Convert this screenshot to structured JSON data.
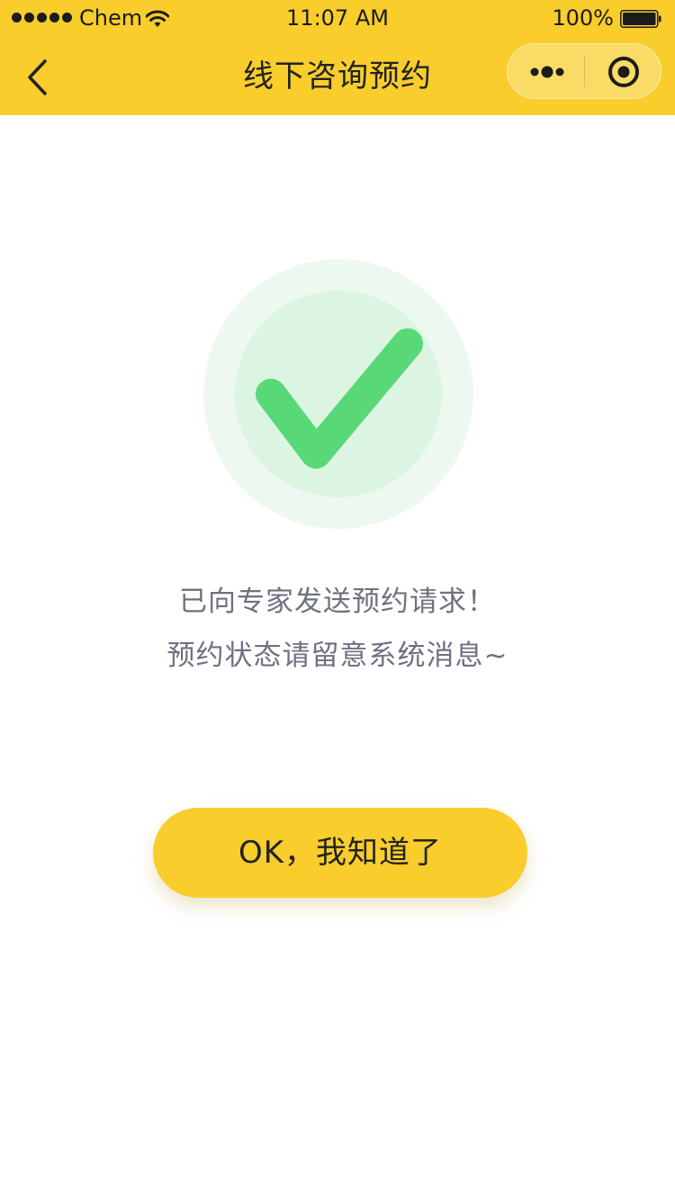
{
  "status_bar": {
    "carrier": "Chem",
    "time": "11:07 AM",
    "battery_percent": "100%",
    "signal_bars": 5
  },
  "nav": {
    "title": "线下咨询预约",
    "back_icon": "chevron-left-icon",
    "menu_icon": "more-dots-icon",
    "close_icon": "target-close-icon"
  },
  "result": {
    "icon": "success-check-icon",
    "line1": "已向专家发送预约请求！",
    "line2": "预约状态请留意系统消息~"
  },
  "actions": {
    "ok_label": "OK，我知道了"
  },
  "colors": {
    "brand_yellow": "#f8cd2c",
    "success_green": "#58d876",
    "success_ring_outer": "#edf9f0",
    "success_ring_inner": "#dcf5e2",
    "message_text": "#6e7180"
  }
}
